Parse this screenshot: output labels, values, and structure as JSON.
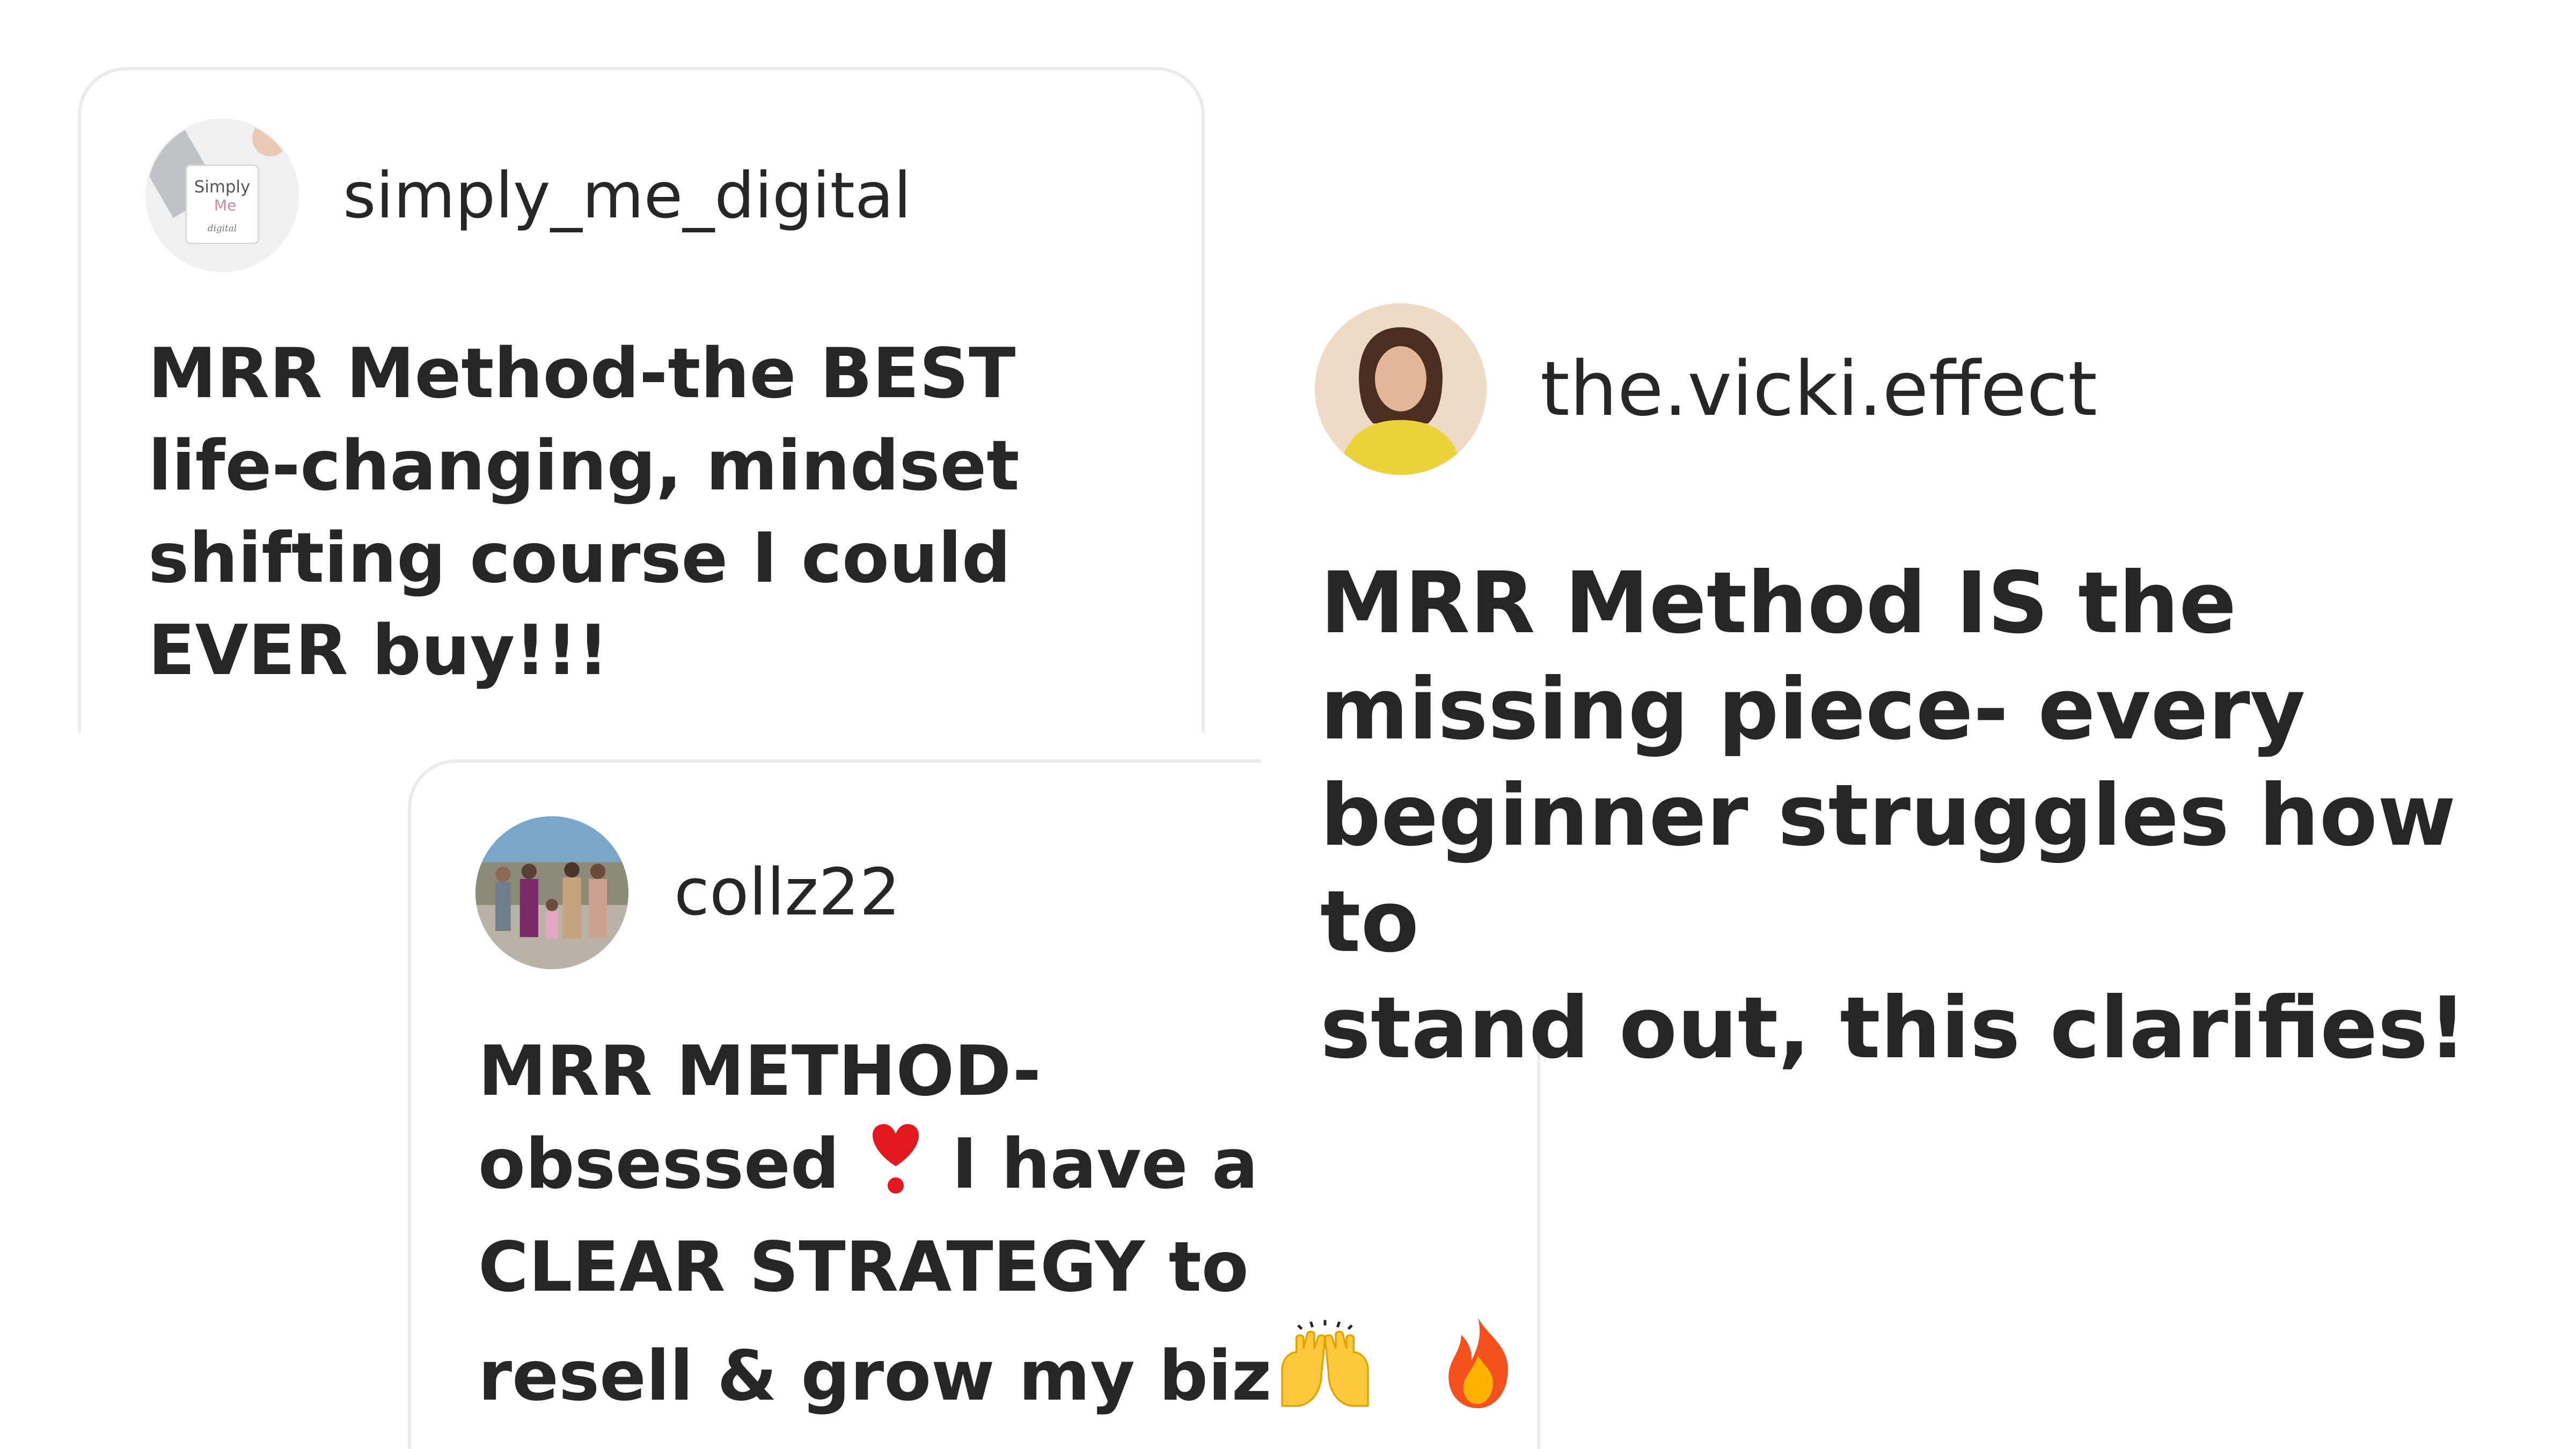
{
  "comments": [
    {
      "username": "simply_me_digital",
      "avatar_icon": "simply-me-digital-logo-avatar",
      "avatar_text": [
        "Simply",
        "Me",
        "digital"
      ],
      "message_lines": [
        "MRR Method-the BEST",
        "life-changing, mindset",
        "shifting course I could",
        "EVER buy!!!"
      ]
    },
    {
      "username": "the.vicki.effect",
      "avatar_icon": "woman-yellow-sweater-avatar",
      "message_lines": [
        "MRR Method IS the",
        "missing piece- every",
        "beginner struggles how to",
        "stand out, this clarifies!"
      ]
    },
    {
      "username": "collz22",
      "avatar_icon": "family-group-photo-avatar",
      "message_lines": [
        "MRR METHOD-",
        "obsessed",
        "I have a",
        "CLEAR STRATEGY to",
        "resell & grow my biz"
      ],
      "emojis": [
        "heart-exclamation-emoji",
        "raising-hands-emoji",
        "fire-emoji"
      ]
    }
  ],
  "colors": {
    "text": "#262626",
    "card_border": "#ebebeb",
    "background": "#ffffff",
    "heart_red": "#e4161e",
    "hands_yellow": "#ffc83d",
    "fire_orange": "#f4511e"
  }
}
